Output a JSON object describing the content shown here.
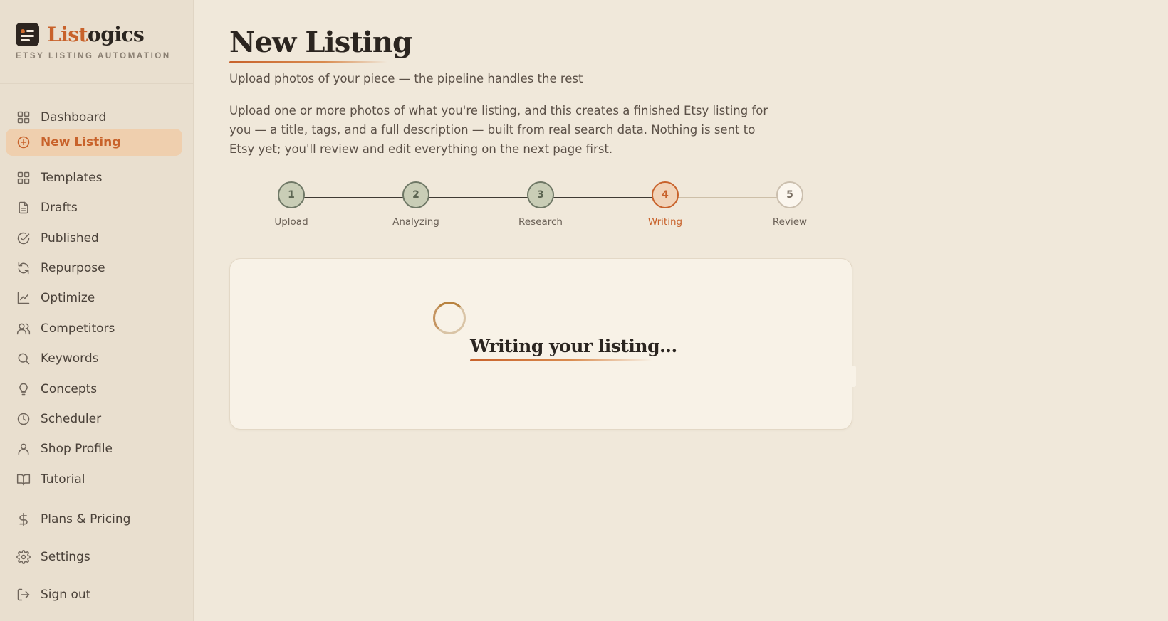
{
  "brand": {
    "name_part1": "List",
    "name_part2": "ogics",
    "tagline": "ETSY LISTING AUTOMATION"
  },
  "sidebar": {
    "items": [
      {
        "label": "Dashboard",
        "icon": "grid-icon"
      },
      {
        "label": "New Listing",
        "icon": "plus-circle-icon",
        "active": true
      },
      {
        "label": "Templates",
        "icon": "grid-icon"
      },
      {
        "label": "Drafts",
        "icon": "document-icon"
      },
      {
        "label": "Published",
        "icon": "check-circle-icon"
      },
      {
        "label": "Repurpose",
        "icon": "refresh-icon"
      },
      {
        "label": "Optimize",
        "icon": "chart-line-icon"
      },
      {
        "label": "Competitors",
        "icon": "users-icon"
      },
      {
        "label": "Keywords",
        "icon": "search-icon"
      },
      {
        "label": "Concepts",
        "icon": "lightbulb-icon"
      },
      {
        "label": "Scheduler",
        "icon": "clock-icon"
      },
      {
        "label": "Shop Profile",
        "icon": "user-icon"
      },
      {
        "label": "Tutorial",
        "icon": "book-icon"
      }
    ],
    "bottom": [
      {
        "label": "Plans & Pricing",
        "icon": "dollar-icon"
      },
      {
        "label": "Settings",
        "icon": "gear-icon"
      },
      {
        "label": "Sign out",
        "icon": "sign-out-icon"
      }
    ]
  },
  "main": {
    "title": "New Listing",
    "subtitle": "Upload photos of your piece — the pipeline handles the rest",
    "intro": "Upload one or more photos of what you're listing, and this creates a finished Etsy listing for you — a title, tags, and a full description — built from real search data. Nothing is sent to Etsy yet; you'll review and edit everything on the next page first."
  },
  "stepper": {
    "steps": [
      {
        "number": "1",
        "label": "Upload",
        "state": "done"
      },
      {
        "number": "2",
        "label": "Analyzing",
        "state": "done"
      },
      {
        "number": "3",
        "label": "Research",
        "state": "done"
      },
      {
        "number": "4",
        "label": "Writing",
        "state": "current"
      },
      {
        "number": "5",
        "label": "Review",
        "state": "pending"
      }
    ]
  },
  "status_card": {
    "title": "Writing your listing..."
  },
  "colors": {
    "accent": "#c8622b",
    "background": "#f0e8da",
    "sidebar": "#e9dfcf",
    "active_nav": "#efcfae",
    "done_step": "#c9cdb6"
  }
}
